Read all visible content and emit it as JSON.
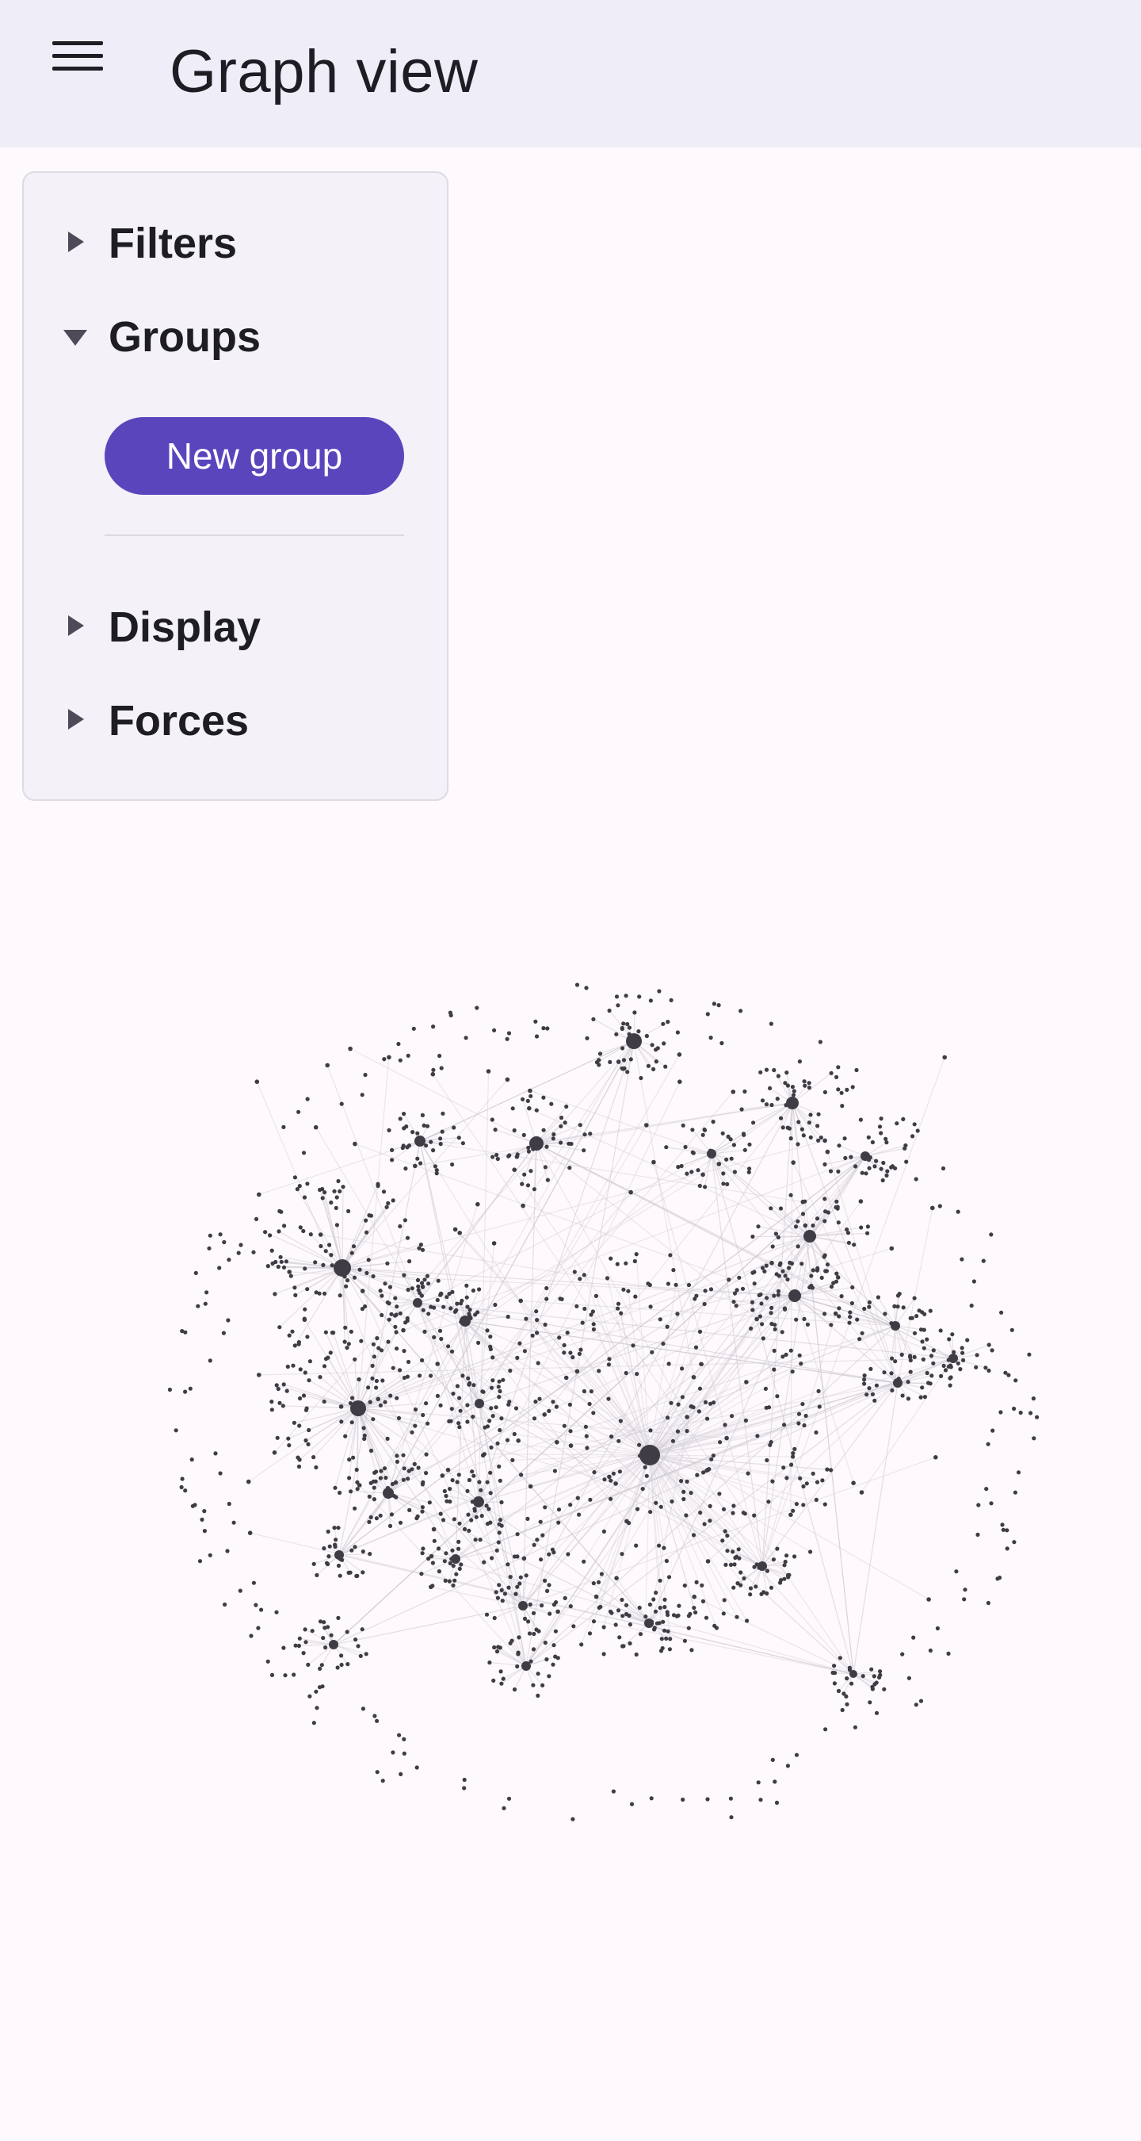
{
  "header": {
    "title": "Graph view",
    "menu_icon": "hamburger-menu-icon",
    "background": "#efedf7"
  },
  "panel": {
    "sections": [
      {
        "label": "Filters",
        "expanded": false
      },
      {
        "label": "Groups",
        "expanded": true
      },
      {
        "label": "Display",
        "expanded": false
      },
      {
        "label": "Forces",
        "expanded": false
      }
    ],
    "new_group_label": "New group",
    "accent": "#5b45bd"
  },
  "graph": {
    "node_color": "#3f3c45",
    "edge_color": "#cdc8d2",
    "seed": 7
  }
}
